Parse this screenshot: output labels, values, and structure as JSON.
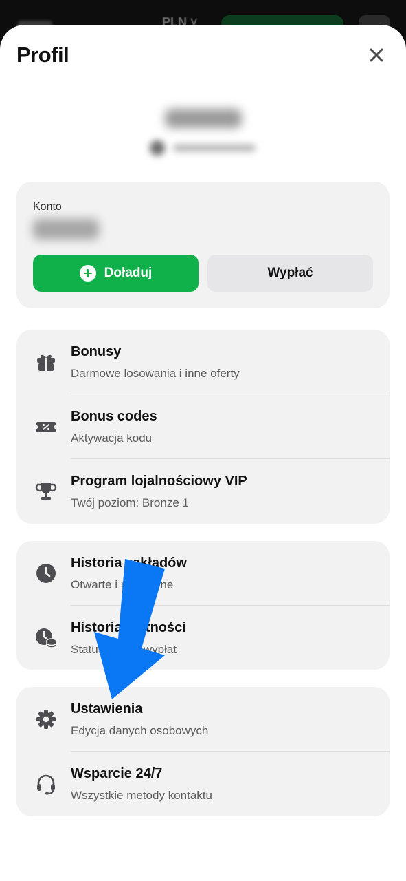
{
  "background_app": {
    "currency": "PLN"
  },
  "sheet": {
    "title": "Profil",
    "close_icon": "close-icon"
  },
  "account": {
    "label": "Konto",
    "topup_label": "Doładuj",
    "withdraw_label": "Wypłać"
  },
  "menu_groups": [
    [
      {
        "title": "Bonusy",
        "subtitle": "Darmowe losowania i inne oferty",
        "icon": "gift-icon"
      },
      {
        "title": "Bonus codes",
        "subtitle": "Aktywacja kodu",
        "icon": "coupon-icon"
      },
      {
        "title": "Program lojalnościowy VIP",
        "subtitle": "Twój poziom: Bronze 1",
        "icon": "trophy-icon"
      }
    ],
    [
      {
        "title": "Historia zakładów",
        "subtitle": "Otwarte i rozliczone",
        "icon": "clock-icon"
      },
      {
        "title": "Historia płatności",
        "subtitle": "Status wpłat i wypłat",
        "icon": "payment-history-icon"
      }
    ],
    [
      {
        "title": "Ustawienia",
        "subtitle": "Edycja danych osobowych",
        "icon": "gear-icon"
      },
      {
        "title": "Wsparcie 24/7",
        "subtitle": "Wszystkie metody kontaktu",
        "icon": "headset-icon"
      }
    ]
  ],
  "colors": {
    "accent_green": "#10b14b",
    "annotation_arrow": "#0a78f5"
  }
}
